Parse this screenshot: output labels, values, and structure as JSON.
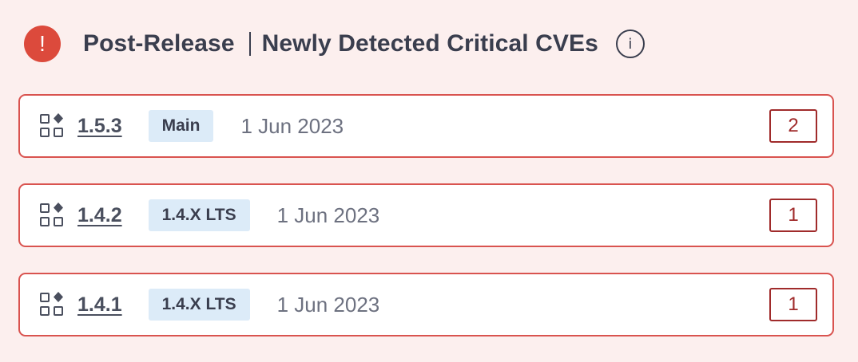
{
  "header": {
    "alert_icon": "alert-circle-icon",
    "alert_glyph": "!",
    "title_prefix": "Post-Release",
    "title_main": "Newly Detected Critical CVEs",
    "info_icon": "info-circle-icon",
    "info_glyph": "i"
  },
  "colors": {
    "background": "#fcefee",
    "alert": "#dc4a3c",
    "row_border": "#d9534f",
    "badge_bg": "#dcebf8",
    "count_color": "#a02b2b"
  },
  "releases": [
    {
      "icon": "apps-grid-icon",
      "version": "1.5.3",
      "branch": "Main",
      "date": "1 Jun 2023",
      "critical_count": "2"
    },
    {
      "icon": "apps-grid-icon",
      "version": "1.4.2",
      "branch": "1.4.X LTS",
      "date": "1 Jun 2023",
      "critical_count": "1"
    },
    {
      "icon": "apps-grid-icon",
      "version": "1.4.1",
      "branch": "1.4.X LTS",
      "date": "1 Jun 2023",
      "critical_count": "1"
    }
  ]
}
